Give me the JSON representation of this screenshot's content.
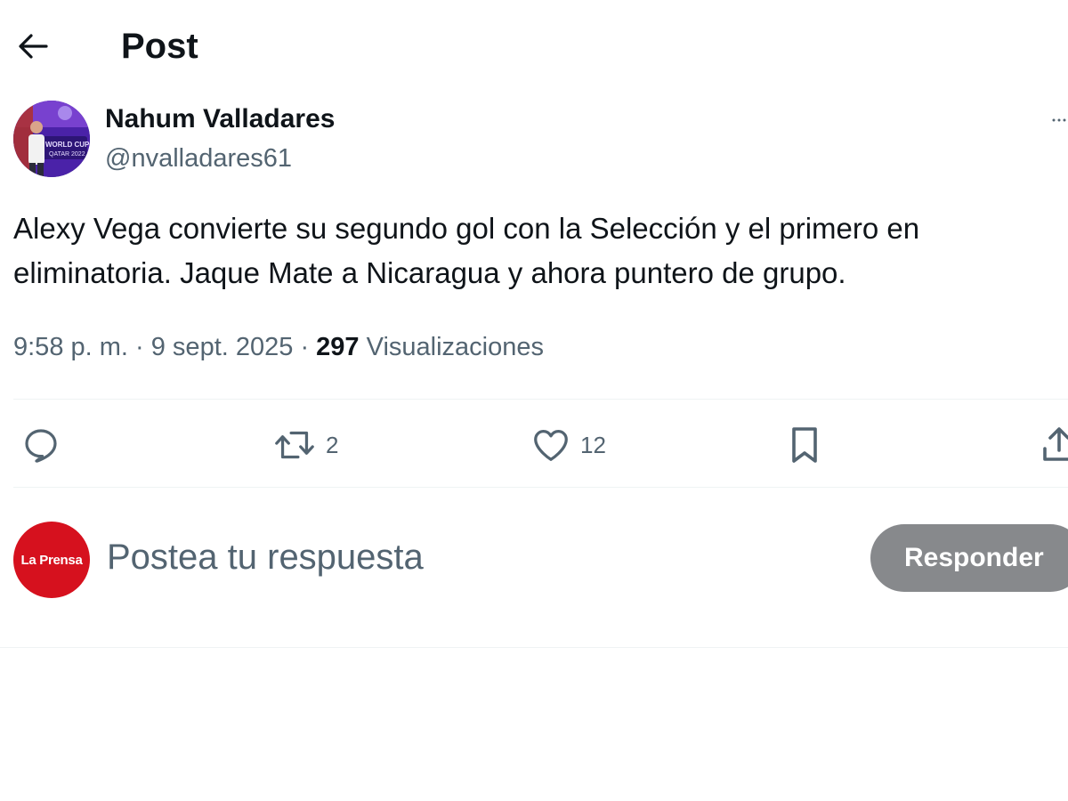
{
  "header": {
    "title": "Post"
  },
  "post": {
    "author": {
      "name": "Nahum Valladares",
      "handle": "@nvalladares61"
    },
    "text": "Alexy Vega convierte su segundo gol con la Selección y el primero en eliminatoria. Jaque Mate a Nicaragua y ahora puntero de grupo.",
    "time": "9:58 p. m.",
    "separator": " · ",
    "date": "9 sept. 2025",
    "views_count": "297",
    "views_label": "Visualizaciones",
    "actions": {
      "reply_icon": "reply-icon",
      "repost_icon": "repost-icon",
      "repost_count": "2",
      "like_icon": "heart-icon",
      "like_count": "12",
      "bookmark_icon": "bookmark-icon",
      "share_icon": "share-icon"
    }
  },
  "composer": {
    "avatar_logo_text": "La Prensa",
    "placeholder": "Postea tu respuesta",
    "button_label": "Responder"
  },
  "colors": {
    "text_primary": "#0f1419",
    "text_secondary": "#536471",
    "divider": "#eff3f4",
    "button_disabled": "#87898c",
    "reply_avatar_brand": "#d6111e"
  }
}
